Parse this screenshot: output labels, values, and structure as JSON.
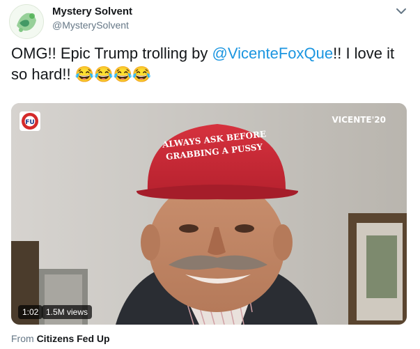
{
  "author": {
    "name": "Mystery Solvent",
    "handle": "@MysterySolvent"
  },
  "tweet": {
    "text_before": "OMG!! Epic Trump trolling by ",
    "mention": "@VicenteFoxQue",
    "text_after": "!! I love it so hard!! ",
    "emoji": "😂😂😂😂"
  },
  "video": {
    "channel_logo_text": "FU",
    "watermark": "VICENTE'20",
    "hat_text_line1": "ALWAYS ASK BEFORE",
    "hat_text_line2": "GRABBING A PUSSY",
    "duration": "1:02",
    "views": "1.5M views"
  },
  "source": {
    "prefix": "From",
    "name": "Citizens Fed Up"
  },
  "colors": {
    "link": "#1b95e0",
    "secondary_text": "#657786",
    "hat_red": "#cc2d38"
  },
  "icons": {
    "caret": "chevron-down-icon",
    "logo": "fu-channel-logo"
  }
}
